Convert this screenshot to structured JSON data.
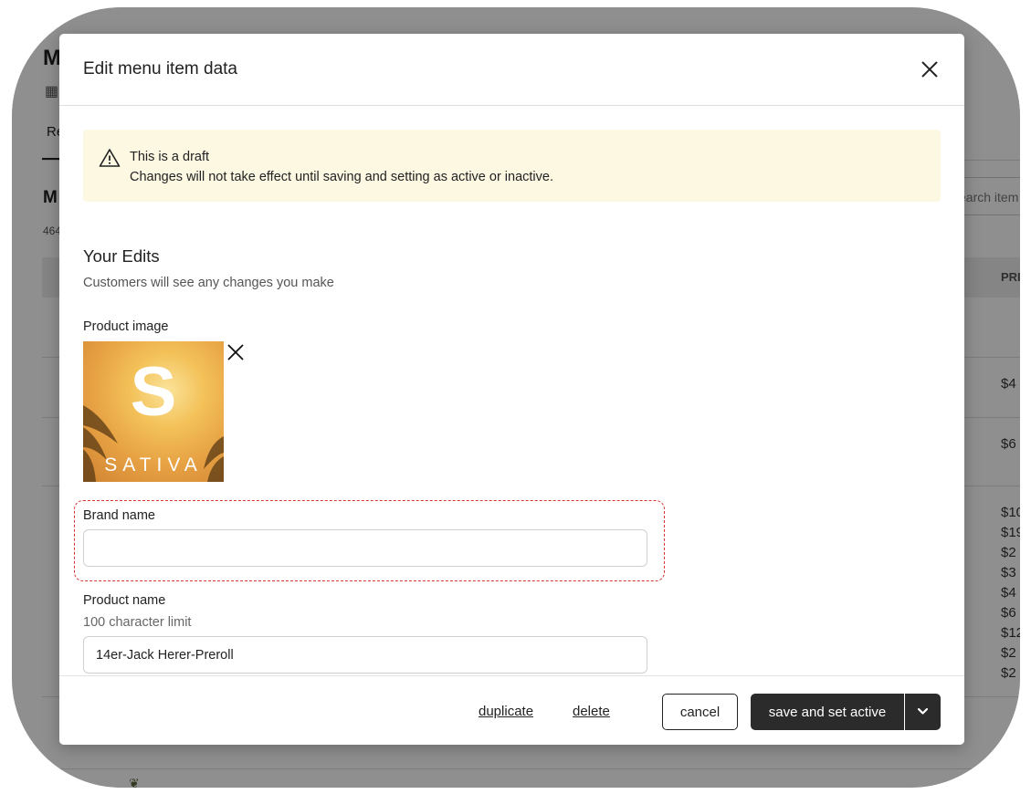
{
  "background": {
    "title": "M",
    "tab_label": "Re",
    "section_label": "M",
    "count_text": "464",
    "search_placeholder": "earch item",
    "price_header": "PRI",
    "prices": [
      "$4",
      "$6",
      "$10",
      "$19",
      "$2",
      "$3",
      "$4",
      "$6",
      "$12",
      "$2",
      "$2"
    ]
  },
  "modal": {
    "title": "Edit menu item data",
    "close_icon": "close-icon"
  },
  "draft_banner": {
    "icon": "warning-icon",
    "title": "This is a draft",
    "message": "Changes will not take effect until saving and setting as active or inactive."
  },
  "edits": {
    "title": "Your Edits",
    "subtitle": "Customers will see any changes you make"
  },
  "product_image": {
    "label": "Product image",
    "letter": "S",
    "caption": "SATIVA"
  },
  "brand_name": {
    "label": "Brand name",
    "value": ""
  },
  "product_name": {
    "label": "Product name",
    "hint": "100 character limit",
    "value": "14er-Jack Herer-Preroll"
  },
  "footer": {
    "duplicate_label": "duplicate",
    "delete_label": "delete",
    "cancel_label": "cancel",
    "save_label": "save and set active"
  },
  "colors": {
    "primary_button": "#2b2b2b",
    "banner_bg": "#fcf8e2",
    "highlight": "#d63333"
  }
}
